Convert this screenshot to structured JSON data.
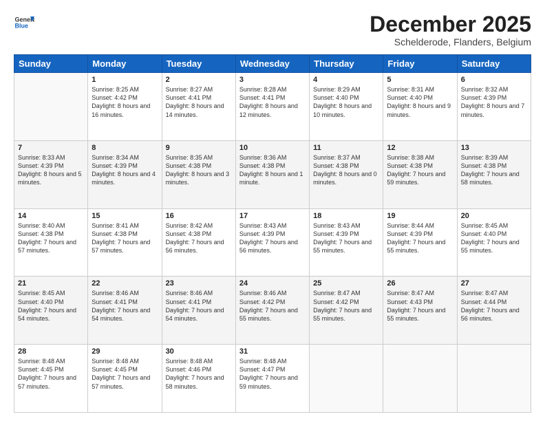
{
  "logo": {
    "general": "General",
    "blue": "Blue"
  },
  "header": {
    "month": "December 2025",
    "location": "Schelderode, Flanders, Belgium"
  },
  "weekdays": [
    "Sunday",
    "Monday",
    "Tuesday",
    "Wednesday",
    "Thursday",
    "Friday",
    "Saturday"
  ],
  "weeks": [
    [
      {
        "day": "",
        "sunrise": "",
        "sunset": "",
        "daylight": ""
      },
      {
        "day": "1",
        "sunrise": "Sunrise: 8:25 AM",
        "sunset": "Sunset: 4:42 PM",
        "daylight": "Daylight: 8 hours and 16 minutes."
      },
      {
        "day": "2",
        "sunrise": "Sunrise: 8:27 AM",
        "sunset": "Sunset: 4:41 PM",
        "daylight": "Daylight: 8 hours and 14 minutes."
      },
      {
        "day": "3",
        "sunrise": "Sunrise: 8:28 AM",
        "sunset": "Sunset: 4:41 PM",
        "daylight": "Daylight: 8 hours and 12 minutes."
      },
      {
        "day": "4",
        "sunrise": "Sunrise: 8:29 AM",
        "sunset": "Sunset: 4:40 PM",
        "daylight": "Daylight: 8 hours and 10 minutes."
      },
      {
        "day": "5",
        "sunrise": "Sunrise: 8:31 AM",
        "sunset": "Sunset: 4:40 PM",
        "daylight": "Daylight: 8 hours and 9 minutes."
      },
      {
        "day": "6",
        "sunrise": "Sunrise: 8:32 AM",
        "sunset": "Sunset: 4:39 PM",
        "daylight": "Daylight: 8 hours and 7 minutes."
      }
    ],
    [
      {
        "day": "7",
        "sunrise": "Sunrise: 8:33 AM",
        "sunset": "Sunset: 4:39 PM",
        "daylight": "Daylight: 8 hours and 5 minutes."
      },
      {
        "day": "8",
        "sunrise": "Sunrise: 8:34 AM",
        "sunset": "Sunset: 4:39 PM",
        "daylight": "Daylight: 8 hours and 4 minutes."
      },
      {
        "day": "9",
        "sunrise": "Sunrise: 8:35 AM",
        "sunset": "Sunset: 4:38 PM",
        "daylight": "Daylight: 8 hours and 3 minutes."
      },
      {
        "day": "10",
        "sunrise": "Sunrise: 8:36 AM",
        "sunset": "Sunset: 4:38 PM",
        "daylight": "Daylight: 8 hours and 1 minute."
      },
      {
        "day": "11",
        "sunrise": "Sunrise: 8:37 AM",
        "sunset": "Sunset: 4:38 PM",
        "daylight": "Daylight: 8 hours and 0 minutes."
      },
      {
        "day": "12",
        "sunrise": "Sunrise: 8:38 AM",
        "sunset": "Sunset: 4:38 PM",
        "daylight": "Daylight: 7 hours and 59 minutes."
      },
      {
        "day": "13",
        "sunrise": "Sunrise: 8:39 AM",
        "sunset": "Sunset: 4:38 PM",
        "daylight": "Daylight: 7 hours and 58 minutes."
      }
    ],
    [
      {
        "day": "14",
        "sunrise": "Sunrise: 8:40 AM",
        "sunset": "Sunset: 4:38 PM",
        "daylight": "Daylight: 7 hours and 57 minutes."
      },
      {
        "day": "15",
        "sunrise": "Sunrise: 8:41 AM",
        "sunset": "Sunset: 4:38 PM",
        "daylight": "Daylight: 7 hours and 57 minutes."
      },
      {
        "day": "16",
        "sunrise": "Sunrise: 8:42 AM",
        "sunset": "Sunset: 4:38 PM",
        "daylight": "Daylight: 7 hours and 56 minutes."
      },
      {
        "day": "17",
        "sunrise": "Sunrise: 8:43 AM",
        "sunset": "Sunset: 4:39 PM",
        "daylight": "Daylight: 7 hours and 56 minutes."
      },
      {
        "day": "18",
        "sunrise": "Sunrise: 8:43 AM",
        "sunset": "Sunset: 4:39 PM",
        "daylight": "Daylight: 7 hours and 55 minutes."
      },
      {
        "day": "19",
        "sunrise": "Sunrise: 8:44 AM",
        "sunset": "Sunset: 4:39 PM",
        "daylight": "Daylight: 7 hours and 55 minutes."
      },
      {
        "day": "20",
        "sunrise": "Sunrise: 8:45 AM",
        "sunset": "Sunset: 4:40 PM",
        "daylight": "Daylight: 7 hours and 55 minutes."
      }
    ],
    [
      {
        "day": "21",
        "sunrise": "Sunrise: 8:45 AM",
        "sunset": "Sunset: 4:40 PM",
        "daylight": "Daylight: 7 hours and 54 minutes."
      },
      {
        "day": "22",
        "sunrise": "Sunrise: 8:46 AM",
        "sunset": "Sunset: 4:41 PM",
        "daylight": "Daylight: 7 hours and 54 minutes."
      },
      {
        "day": "23",
        "sunrise": "Sunrise: 8:46 AM",
        "sunset": "Sunset: 4:41 PM",
        "daylight": "Daylight: 7 hours and 54 minutes."
      },
      {
        "day": "24",
        "sunrise": "Sunrise: 8:46 AM",
        "sunset": "Sunset: 4:42 PM",
        "daylight": "Daylight: 7 hours and 55 minutes."
      },
      {
        "day": "25",
        "sunrise": "Sunrise: 8:47 AM",
        "sunset": "Sunset: 4:42 PM",
        "daylight": "Daylight: 7 hours and 55 minutes."
      },
      {
        "day": "26",
        "sunrise": "Sunrise: 8:47 AM",
        "sunset": "Sunset: 4:43 PM",
        "daylight": "Daylight: 7 hours and 55 minutes."
      },
      {
        "day": "27",
        "sunrise": "Sunrise: 8:47 AM",
        "sunset": "Sunset: 4:44 PM",
        "daylight": "Daylight: 7 hours and 56 minutes."
      }
    ],
    [
      {
        "day": "28",
        "sunrise": "Sunrise: 8:48 AM",
        "sunset": "Sunset: 4:45 PM",
        "daylight": "Daylight: 7 hours and 57 minutes."
      },
      {
        "day": "29",
        "sunrise": "Sunrise: 8:48 AM",
        "sunset": "Sunset: 4:45 PM",
        "daylight": "Daylight: 7 hours and 57 minutes."
      },
      {
        "day": "30",
        "sunrise": "Sunrise: 8:48 AM",
        "sunset": "Sunset: 4:46 PM",
        "daylight": "Daylight: 7 hours and 58 minutes."
      },
      {
        "day": "31",
        "sunrise": "Sunrise: 8:48 AM",
        "sunset": "Sunset: 4:47 PM",
        "daylight": "Daylight: 7 hours and 59 minutes."
      },
      {
        "day": "",
        "sunrise": "",
        "sunset": "",
        "daylight": ""
      },
      {
        "day": "",
        "sunrise": "",
        "sunset": "",
        "daylight": ""
      },
      {
        "day": "",
        "sunrise": "",
        "sunset": "",
        "daylight": ""
      }
    ]
  ]
}
